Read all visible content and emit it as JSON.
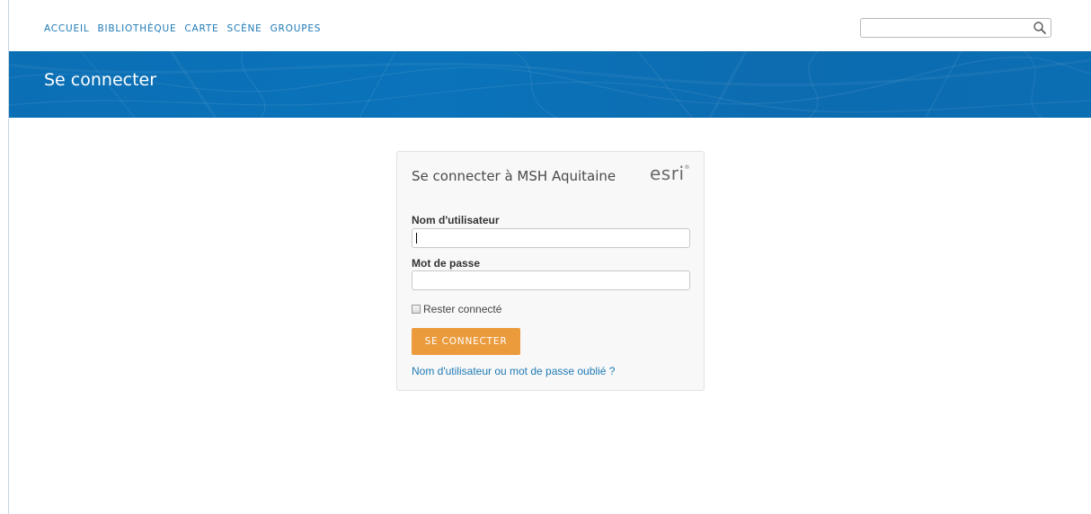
{
  "nav": {
    "items": [
      "ACCUEIL",
      "BIBLIOTHÈQUE",
      "CARTE",
      "SCÈNE",
      "GROUPES"
    ],
    "search_value": "",
    "search_icon": "magnifier-icon"
  },
  "banner": {
    "title": "Se connecter"
  },
  "login": {
    "title": "Se connecter à MSH Aquitaine",
    "logo_text": "esri",
    "logo_mark": "®",
    "username_label": "Nom d'utilisateur",
    "username_value": "",
    "password_label": "Mot de passe",
    "password_value": "",
    "remember_label": "Rester connecté",
    "remember_checked": false,
    "submit_label": "SE CONNECTER",
    "forgot_link": "Nom d'utilisateur ou mot de passe oublié ?"
  },
  "colors": {
    "accent": "#1f7ab6",
    "banner": "#0b6fb5",
    "button": "#eb9b3c"
  }
}
